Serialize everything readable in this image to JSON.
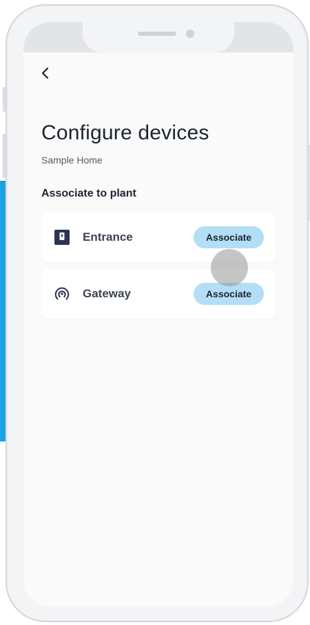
{
  "header": {
    "back_icon": "chevron-left-icon",
    "title": "Configure devices",
    "subtitle": "Sample Home"
  },
  "section": {
    "title": "Associate to plant"
  },
  "devices": [
    {
      "name": "Entrance",
      "icon": "door-panel-icon",
      "action_label": "Associate"
    },
    {
      "name": "Gateway",
      "icon": "gateway-signal-icon",
      "action_label": "Associate"
    }
  ],
  "colors": {
    "accent": "#b3def6",
    "icon": "#2a3550",
    "text_primary": "#1c2430",
    "background_strip": "#1aa3e0"
  }
}
